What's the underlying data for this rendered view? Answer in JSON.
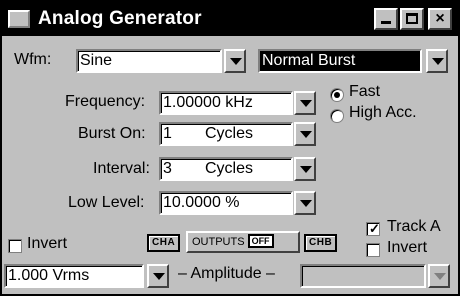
{
  "window": {
    "title": "Analog Generator",
    "min_glyph": "_",
    "close_glyph": "×"
  },
  "waveform": {
    "label": "Wfm:",
    "value": "Sine",
    "mode": "Normal Burst"
  },
  "frequency": {
    "label": "Frequency:",
    "value": "1.00000 kHz"
  },
  "speed": {
    "options": [
      "Fast",
      "High Acc."
    ],
    "selected": "Fast"
  },
  "burst_on": {
    "label": "Burst On:",
    "value": "1",
    "unit": "Cycles"
  },
  "interval": {
    "label": "Interval:",
    "value": "3",
    "unit": "Cycles"
  },
  "low_level": {
    "label": "Low Level:",
    "value": "10.0000 %"
  },
  "track_a": {
    "label": "Track A",
    "checked": true
  },
  "invert_left": {
    "label": "Invert",
    "checked": false
  },
  "invert_right": {
    "label": "Invert",
    "checked": false
  },
  "channels": {
    "cha": "CHA",
    "chb": "CHB",
    "outputs": "OUTPUTS",
    "outputs_state": "OFF"
  },
  "amplitude": {
    "value": "1.000  Vrms",
    "label": "– Amplitude –",
    "value_b": ""
  }
}
